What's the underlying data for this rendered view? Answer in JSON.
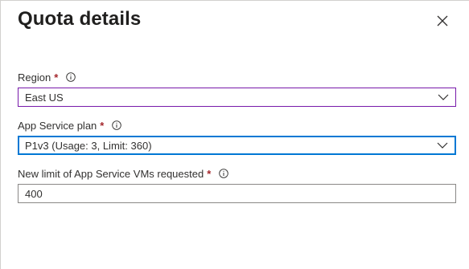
{
  "panel": {
    "title": "Quota details",
    "close_icon": "close-icon"
  },
  "fields": {
    "region": {
      "label": "Region",
      "required_mark": "*",
      "value": "East US"
    },
    "plan": {
      "label": "App Service plan",
      "required_mark": "*",
      "value": "P1v3 (Usage: 3, Limit: 360)"
    },
    "limit": {
      "label": "New limit of App Service VMs requested",
      "required_mark": "*",
      "value": "400"
    }
  },
  "colors": {
    "required": "#a4262c",
    "focus_border": "#0078d4",
    "hover_border": "#7719aa"
  },
  "icons": [
    "info-icon",
    "chevron-down-icon",
    "close-icon"
  ]
}
